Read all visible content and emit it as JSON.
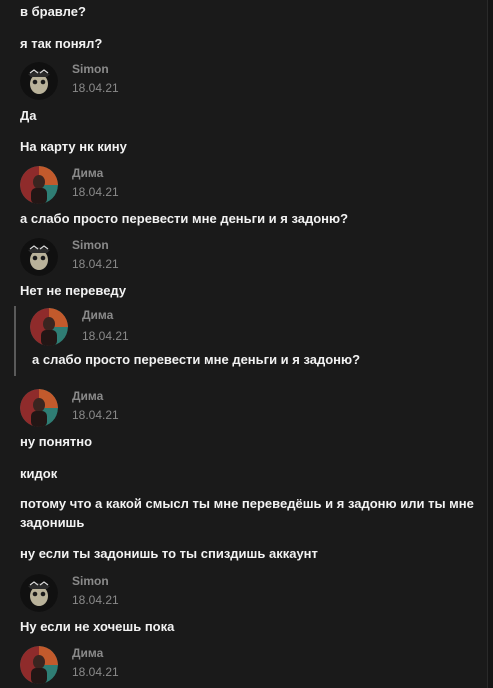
{
  "messages": {
    "m1": "в бравле?",
    "m2": "я так понял?",
    "m3": "Да",
    "m4": "На карту нк кину",
    "m5": "а слабо просто перевести мне деньги и я задоню?",
    "m6": "Нет не переведу",
    "m7": "ну понятно",
    "m8": "кидок",
    "m9": "потому что а какой смысл ты мне переведёшь и я задоню или ты мне задонишь",
    "m10": "ну если ты задонишь то ты спиздишь аккаунт",
    "m11": "Ну если не хочешь пока"
  },
  "authors": {
    "a1": {
      "name": "Simon",
      "date": "18.04.21"
    },
    "a2": {
      "name": "Дима",
      "date": "18.04.21"
    },
    "a3": {
      "name": "Simon",
      "date": "18.04.21"
    },
    "a4": {
      "name": "Дима",
      "date": "18.04.21"
    },
    "a5": {
      "name": "Дима",
      "date": "18.04.21"
    },
    "a6": {
      "name": "Simon",
      "date": "18.04.21"
    },
    "a7": {
      "name": "Дима",
      "date": "18.04.21"
    }
  },
  "quote": {
    "name": "Дима",
    "date": "18.04.21",
    "text": "а слабо просто перевести мне деньги и я задоню?"
  },
  "colors": {
    "background": "#1a1a1a",
    "text": "#f2f2f2",
    "meta": "#8a8a8a",
    "quote_bar": "#5a5a5a"
  }
}
